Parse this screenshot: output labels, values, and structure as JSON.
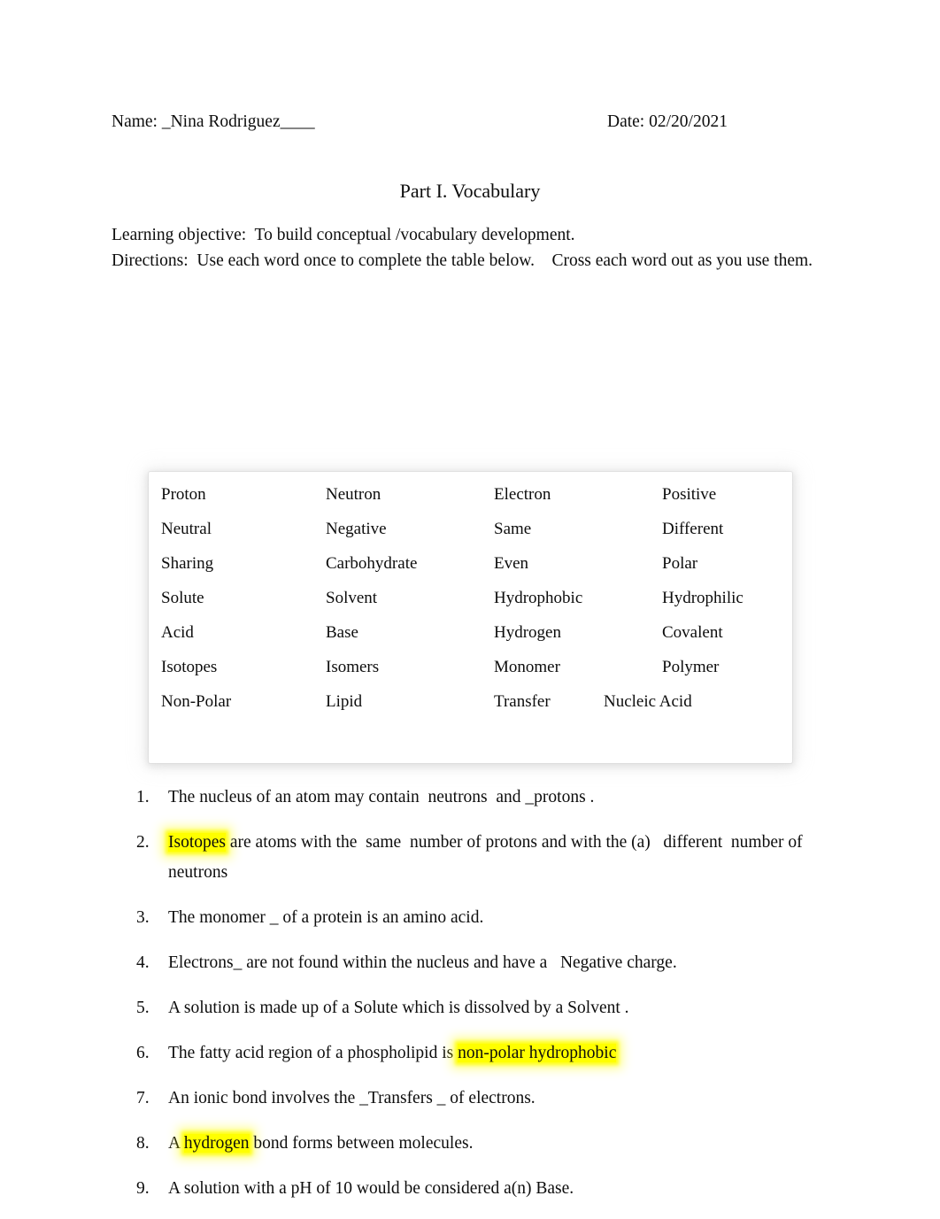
{
  "header": {
    "name_label": "Name: _Nina Rodriguez____",
    "date_label": "Date: 02/20/2021"
  },
  "title": "Part I. Vocabulary",
  "intro": {
    "objective": "Learning objective:  To build conceptual /vocabulary development.",
    "directions": "Directions:  Use each word once to complete the table below.    Cross each word out as you use them."
  },
  "word_bank": {
    "columns": 4,
    "rows": [
      [
        "Proton",
        "Neutron",
        "Electron",
        "Positive"
      ],
      [
        "Neutral",
        "Negative",
        "Same",
        "Different"
      ],
      [
        "Sharing",
        "Carbohydrate",
        "Even",
        "Polar"
      ],
      [
        "Solute",
        "Solvent",
        "Hydrophobic",
        "Hydrophilic"
      ],
      [
        "Acid",
        "Base",
        "Hydrogen",
        "Covalent"
      ],
      [
        "Isotopes",
        "Isomers",
        "Monomer",
        "Polymer"
      ],
      [
        "Non-Polar",
        "Lipid",
        "Transfer",
        "Nucleic Acid"
      ]
    ]
  },
  "questions": [
    {
      "number": "1.",
      "parts": [
        {
          "text": "The nucleus of an atom may contain  neutrons  and _protons .",
          "highlight": false
        }
      ]
    },
    {
      "number": "2.",
      "parts": [
        {
          "text": "Isotopes",
          "highlight": true
        },
        {
          "text": " are atoms with the  same  number of protons and with the (a)   different  number of neutrons",
          "highlight": false
        }
      ]
    },
    {
      "number": "3.",
      "parts": [
        {
          "text": "The monomer _ of a protein is an amino acid.",
          "highlight": false
        }
      ]
    },
    {
      "number": "4.",
      "parts": [
        {
          "text": "Electrons_ are not found within the nucleus and have a   Negative charge.",
          "highlight": false
        }
      ]
    },
    {
      "number": "5.",
      "parts": [
        {
          "text": "A solution is made up of a Solute which is dissolved by a Solvent .",
          "highlight": false
        }
      ]
    },
    {
      "number": "6.",
      "parts": [
        {
          "text": "The fatty acid region of a phospholipid is ",
          "highlight": false
        },
        {
          "text": "non-polar hydrophobic",
          "highlight": true
        }
      ]
    },
    {
      "number": "7.",
      "parts": [
        {
          "text": "An ionic bond involves the _Transfers _ of electrons.",
          "highlight": false
        }
      ]
    },
    {
      "number": "8.",
      "parts": [
        {
          "text": "A ",
          "highlight": false
        },
        {
          "text": "hydrogen",
          "highlight": true
        },
        {
          "text": " bond forms between molecules.",
          "highlight": false
        }
      ]
    },
    {
      "number": "9.",
      "parts": [
        {
          "text": "A solution with a pH of 10 would be considered a(n) Base.",
          "highlight": false
        }
      ]
    }
  ],
  "colors": {
    "highlight": "#ffff00",
    "text": "#0d0d0d",
    "page_background": "#ffffff"
  }
}
